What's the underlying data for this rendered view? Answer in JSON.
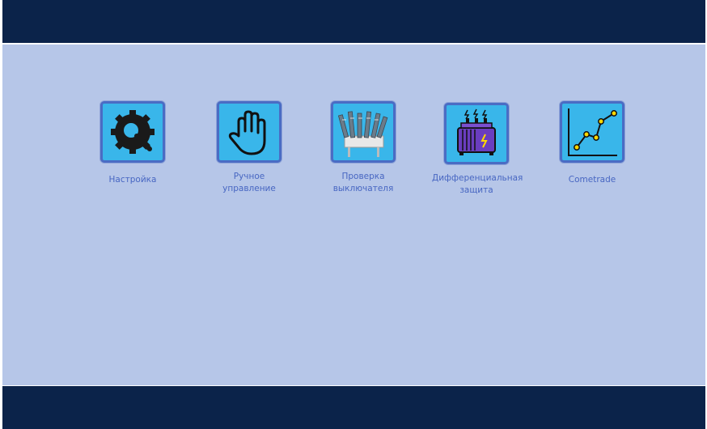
{
  "tiles": [
    {
      "id": "settings",
      "label": "Настройка",
      "icon": "gear-wrench-icon"
    },
    {
      "id": "manual",
      "label": "Ручное\nуправление",
      "icon": "hand-icon"
    },
    {
      "id": "breaker",
      "label": "Проверка\nвыключателя",
      "icon": "circuit-breaker-icon"
    },
    {
      "id": "differential",
      "label": "Дифференциальная\nзащита",
      "icon": "transformer-icon"
    },
    {
      "id": "cometrade",
      "label": "Cometrade",
      "icon": "line-chart-icon"
    }
  ],
  "colors": {
    "header": "#0b234a",
    "background": "#b6c6e8",
    "tile_fill": "#39b6ea",
    "tile_border": "#4a6cc4",
    "label": "#4766c2"
  }
}
